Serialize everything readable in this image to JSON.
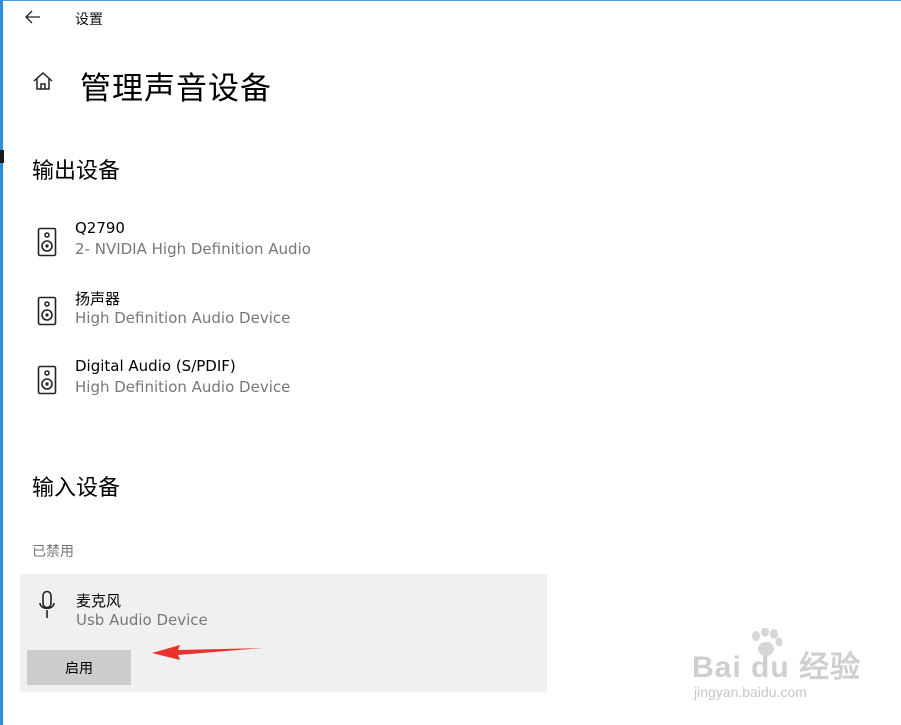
{
  "window": {
    "title": "设置",
    "back_icon": "arrow-left-icon"
  },
  "header": {
    "home_icon": "home-icon",
    "title": "管理声音设备"
  },
  "output_section": {
    "title": "输出设备",
    "devices": [
      {
        "name": "Q2790",
        "subtitle": "2- NVIDIA High Definition Audio",
        "icon": "speaker-icon"
      },
      {
        "name": "扬声器",
        "subtitle": "High Definition Audio Device",
        "icon": "speaker-icon"
      },
      {
        "name": "Digital Audio (S/PDIF)",
        "subtitle": "High Definition Audio Device",
        "icon": "speaker-icon"
      }
    ]
  },
  "input_section": {
    "title": "输入设备",
    "status_label": "已禁用",
    "devices": [
      {
        "name": "麦克风",
        "subtitle": "Usb Audio Device",
        "icon": "microphone-icon",
        "action_label": "启用"
      }
    ]
  },
  "annotation": {
    "arrow_color": "#e8332d"
  },
  "watermark": {
    "logo_text": "Bai du 经验",
    "url": "jingyan.baidu.com"
  },
  "colors": {
    "accent_edge": "#2b8de0",
    "card_bg": "#f0f0f0",
    "button_bg": "#cccccc",
    "secondary_text": "#777777"
  }
}
